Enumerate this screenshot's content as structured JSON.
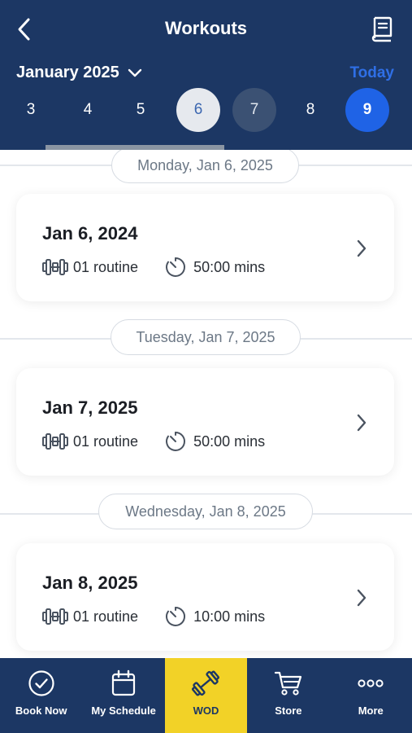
{
  "header": {
    "title": "Workouts",
    "back_icon": "chevron-left-icon",
    "book_icon": "book-icon",
    "month": "January 2025",
    "today_label": "Today",
    "background": "#1c3764",
    "accent": "#1f63e6"
  },
  "days": [
    "3",
    "4",
    "5",
    "6",
    "7",
    "8",
    "9"
  ],
  "sections": [
    {
      "header": "Monday, Jan 6, 2025",
      "card": {
        "date": "Jan 6, 2024",
        "routine": "01 routine",
        "duration": "50:00 mins"
      }
    },
    {
      "header": "Tuesday, Jan 7, 2025",
      "card": {
        "date": "Jan 7, 2025",
        "routine": "01 routine",
        "duration": "50:00 mins"
      }
    },
    {
      "header": "Wednesday, Jan 8, 2025",
      "card": {
        "date": "Jan 8, 2025",
        "routine": "01 routine",
        "duration": "10:00 mins"
      }
    }
  ],
  "nav": {
    "items": [
      {
        "label": "Book Now",
        "icon": "check-circle-icon"
      },
      {
        "label": "My Schedule",
        "icon": "calendar-icon"
      },
      {
        "label": "WOD",
        "icon": "dumbbell-icon"
      },
      {
        "label": "Store",
        "icon": "cart-icon"
      },
      {
        "label": "More",
        "icon": "more-dots-icon"
      }
    ],
    "active_color": "#f2d227"
  }
}
